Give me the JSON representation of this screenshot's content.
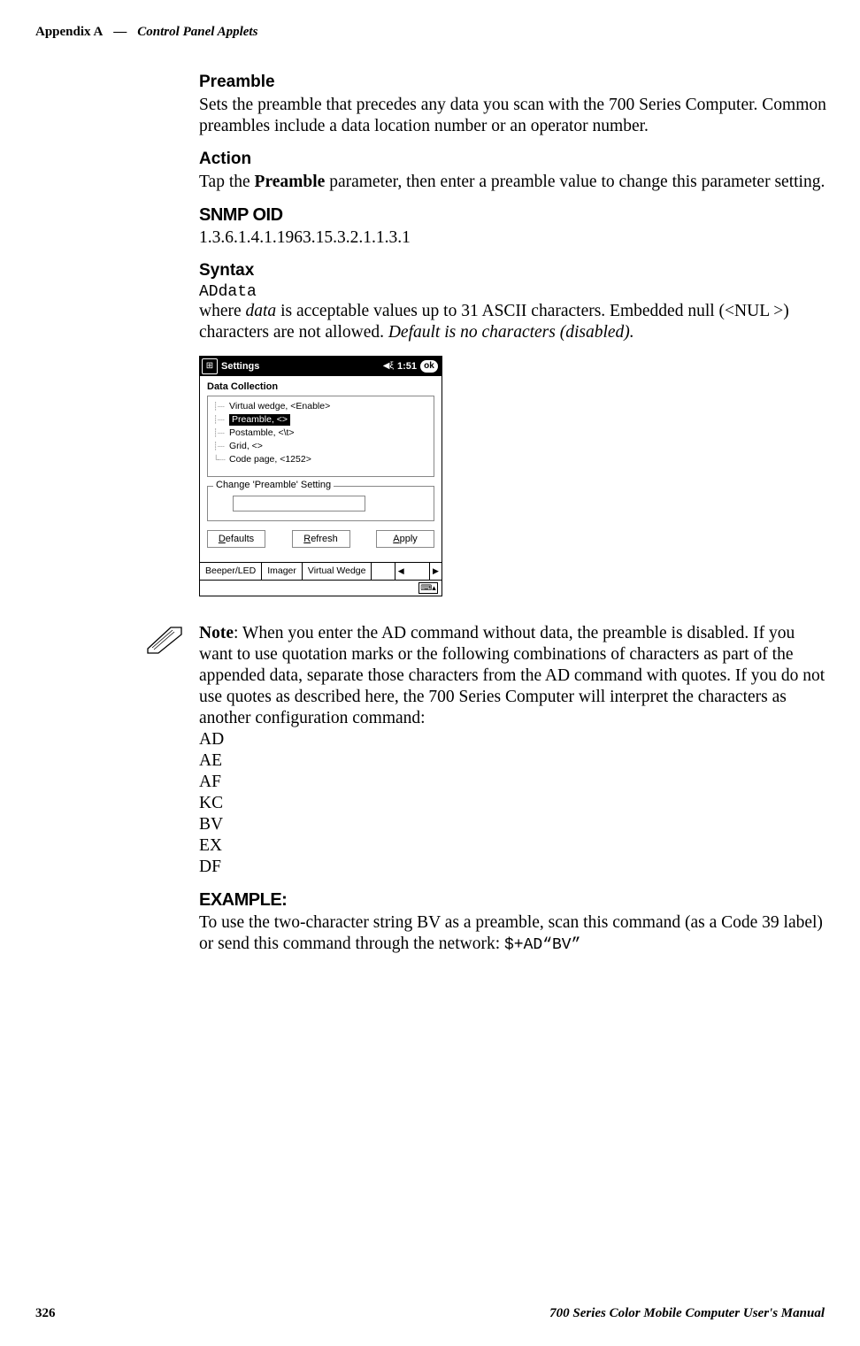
{
  "header": {
    "appendix": "Appendix  A",
    "sep": "—",
    "title": "Control Panel Applets"
  },
  "preamble": {
    "heading": "Preamble",
    "body": "Sets the preamble that precedes any data you scan with the 700 Series Computer. Common preambles include a data location number or an operator number."
  },
  "action": {
    "heading": "Action",
    "body_before": "Tap the ",
    "body_bold": "Preamble",
    "body_after": " parameter, then enter a preamble value to change this parameter setting."
  },
  "snmp": {
    "heading": "SNMP OID",
    "value": "1.3.6.1.4.1.1963.15.3.2.1.1.3.1"
  },
  "syntax": {
    "heading": "Syntax",
    "code": "ADdata",
    "where_before": "where ",
    "where_italic": "data",
    "where_mid": " is acceptable values up to 31 ASCII characters. Embedded null (<NUL >) characters are not allowed. ",
    "where_default_italic": "Default is no characters (disabled)."
  },
  "shot": {
    "title": "Settings",
    "time": "1:51",
    "ok": "ok",
    "section": "Data Collection",
    "tree": [
      "Virtual wedge, <Enable>",
      "Preamble, <>",
      "Postamble, <\\t>",
      "Grid, <>",
      "Code page, <1252>"
    ],
    "group_legend": "Change 'Preamble' Setting",
    "btn_defaults": "Defaults",
    "btn_refresh": "Refresh",
    "btn_apply": "Apply",
    "tabs": [
      "Beeper/LED",
      "Imager",
      "Virtual Wedge"
    ],
    "kb": "⌨▴"
  },
  "note": {
    "label": "Note",
    "body": ": When you enter the AD command without data, the preamble is disabled. If you want to use quotation marks or the following combinations of characters as part of the appended data, separate those characters from the AD command with quotes. If you do not use quotes as described here, the 700 Series Computer will interpret the characters as another configuration command:",
    "codes": [
      "AD",
      "AE",
      "AF",
      "KC",
      "BV",
      "EX",
      "DF"
    ]
  },
  "example": {
    "heading": "EXAMPLE:",
    "body_before": "To use the two-character string BV as a preamble, scan this command (as a Code 39 label) or send this command through the network: ",
    "code": "$+AD“BV”"
  },
  "footer": {
    "page": "326",
    "title": "700 Series Color Mobile Computer User's Manual"
  }
}
